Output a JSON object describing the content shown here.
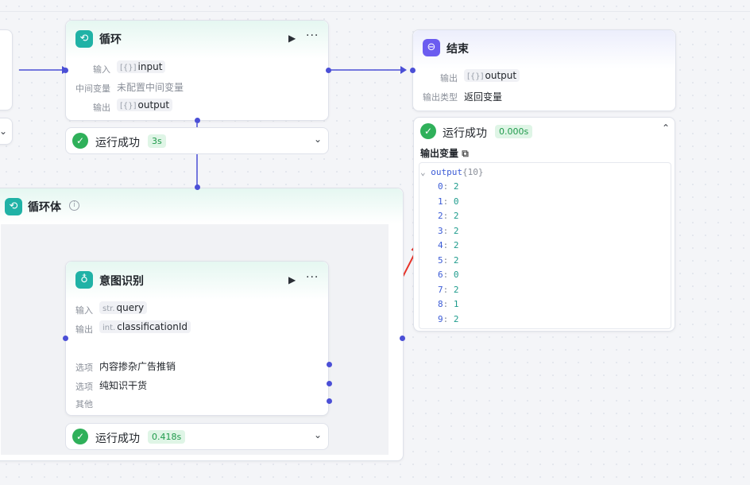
{
  "loop_node": {
    "title": "循环",
    "rows": [
      {
        "label": "输入",
        "value": "input",
        "prefix": "[{}]"
      },
      {
        "label": "中间变量",
        "value": "未配置中间变量"
      },
      {
        "label": "输出",
        "value": "output",
        "prefix": "[{}]"
      }
    ],
    "status": {
      "text": "运行成功",
      "time": "3s"
    }
  },
  "end_node": {
    "title": "结束",
    "rows": [
      {
        "label": "输出",
        "value": "output",
        "prefix": "[{}]"
      },
      {
        "label": "输出类型",
        "value": "返回变量"
      }
    ],
    "status": {
      "text": "运行成功",
      "time": "0.000s"
    },
    "output_title": "输出变量",
    "output_tree": {
      "key": "output",
      "count": "{10}",
      "items": [
        {
          "k": "0",
          "v": "2"
        },
        {
          "k": "1",
          "v": "0"
        },
        {
          "k": "2",
          "v": "2"
        },
        {
          "k": "3",
          "v": "2"
        },
        {
          "k": "4",
          "v": "2"
        },
        {
          "k": "5",
          "v": "2"
        },
        {
          "k": "6",
          "v": "0"
        },
        {
          "k": "7",
          "v": "2"
        },
        {
          "k": "8",
          "v": "1"
        },
        {
          "k": "9",
          "v": "2"
        }
      ]
    }
  },
  "loop_body": {
    "title": "循环体"
  },
  "intent_node": {
    "title": "意图识别",
    "rows": [
      {
        "label": "输入",
        "value": "query",
        "prefix": "str."
      },
      {
        "label": "输出",
        "value": "classificationId",
        "prefix": "int."
      }
    ],
    "options": [
      {
        "label": "选项",
        "value": "内容掺杂广告推销"
      },
      {
        "label": "选项",
        "value": "纯知识干货"
      },
      {
        "label": "其他",
        "value": ""
      }
    ],
    "status": {
      "text": "运行成功",
      "time": "0.418s"
    }
  },
  "colors": {
    "accent": "#4b4fd6",
    "success": "#2fb05a",
    "annotation": "#e8342a"
  }
}
